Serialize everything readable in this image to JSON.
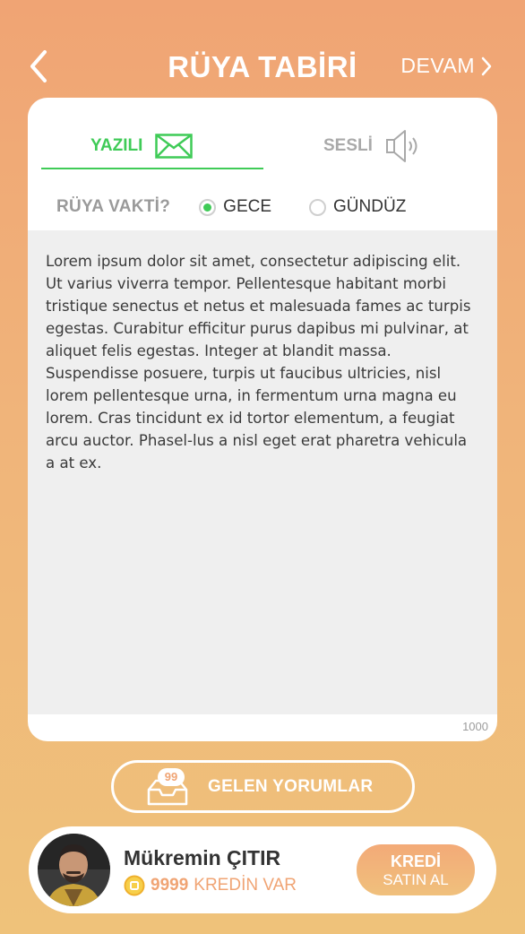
{
  "header": {
    "title": "RÜYA TABİRİ",
    "next_label": "DEVAM",
    "back_icon": "chevron-left-icon",
    "next_icon": "chevron-right-icon"
  },
  "tabs": [
    {
      "label": "YAZILI",
      "icon": "envelope-icon",
      "active": true
    },
    {
      "label": "SESLİ",
      "icon": "speaker-icon",
      "active": false
    }
  ],
  "dream_time": {
    "label": "RÜYA VAKTİ?",
    "options": [
      {
        "label": "GECE",
        "selected": true
      },
      {
        "label": "GÜNDÜZ",
        "selected": false
      }
    ]
  },
  "editor": {
    "text": "Lorem ipsum dolor sit amet, consectetur adipiscing elit. Ut varius viverra tempor. Pellentesque habitant morbi tristique senectus et netus et malesuada fames ac turpis egestas. Curabitur efficitur purus dapibus mi pulvinar, at aliquet felis egestas. Integer at blandit massa. Suspendisse posuere, turpis ut faucibus ultricies, nisl lorem pellentesque urna, in fermentum urna magna eu lorem. Cras tincidunt ex id tortor elementum, a feugiat arcu auctor. Phasel-lus a nisl eget erat pharetra vehicula a at ex.",
    "counter": "1000"
  },
  "comments_button": {
    "label": "GELEN YORUMLAR",
    "badge": "99",
    "icon": "inbox-icon"
  },
  "profile": {
    "name": "Mükremin ÇITIR",
    "credit_amount": "9999",
    "credit_text": "KREDİN VAR",
    "coin_icon": "coin-icon",
    "buy_line1": "KREDİ",
    "buy_line2": "SATIN AL"
  },
  "colors": {
    "accent_green": "#3fcb57",
    "accent_orange": "#f0a474",
    "background_top": "#f0a474",
    "background_bottom": "#efc27a"
  }
}
